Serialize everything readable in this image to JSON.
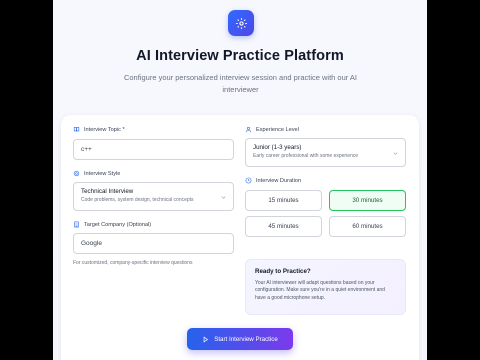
{
  "header": {
    "title": "AI Interview Practice Platform",
    "subtitle": "Configure your personalized interview session and practice with our AI interviewer"
  },
  "form": {
    "topic": {
      "label": "Interview Topic *",
      "value": "c++"
    },
    "style": {
      "label": "Interview Style",
      "selected": "Technical Interview",
      "description": "Code problems, system design, technical concepts"
    },
    "company": {
      "label": "Target Company (Optional)",
      "value": "Google",
      "hint": "For customized, company-specific interview questions"
    },
    "experience": {
      "label": "Experience Level",
      "selected": "Junior (1-3 years)",
      "description": "Early career professional with some experience"
    },
    "duration": {
      "label": "Interview Duration",
      "options": [
        "15 minutes",
        "30 minutes",
        "45 minutes",
        "60 minutes"
      ],
      "selected": "30 minutes"
    }
  },
  "ready": {
    "title": "Ready to Practice?",
    "body": "Your AI interviewer will adapt questions based on your configuration. Make sure you're in a quiet environment and have a good microphone setup."
  },
  "start_button": {
    "label": "Start Interview Practice"
  },
  "colors": {
    "accent": "#2f6bff",
    "selected": "#22c55e",
    "gradient_end": "#7c3aed"
  }
}
